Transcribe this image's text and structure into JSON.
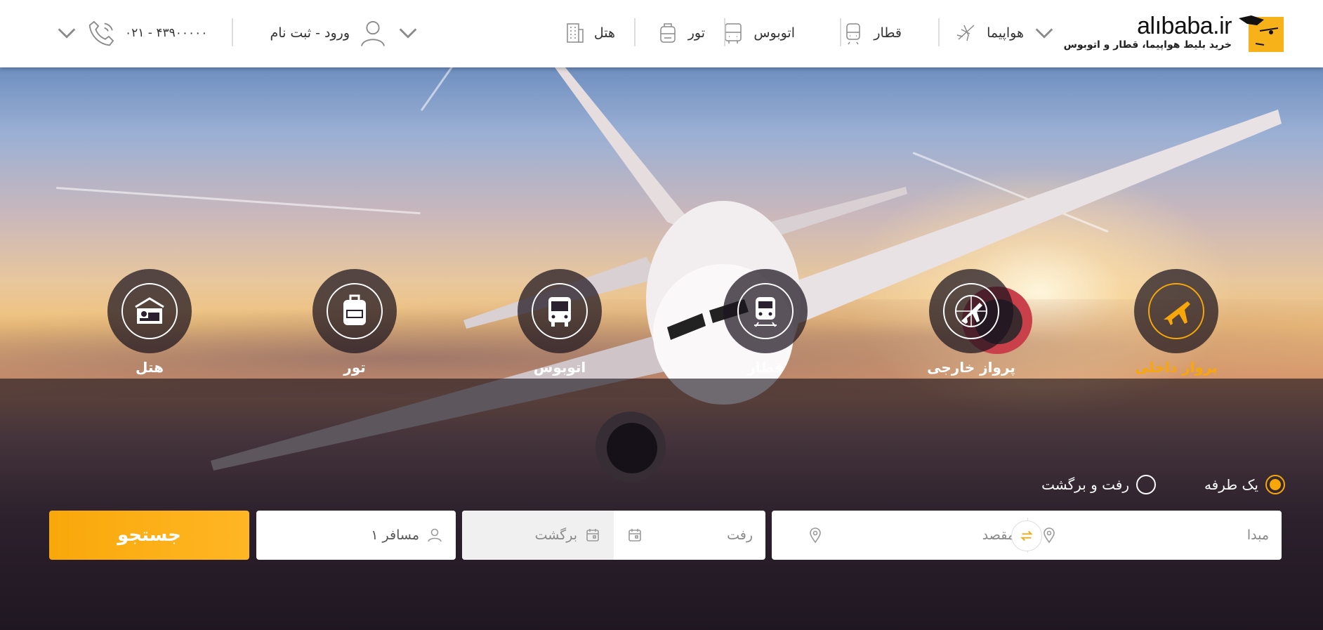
{
  "header": {
    "logo_text": "alıbaba.ir",
    "logo_tagline": "خرید بلیط هواپیما، قطار و اتوبوس",
    "nav": [
      {
        "label": "هواپیما",
        "icon": "plane-icon",
        "has_dropdown": true
      },
      {
        "label": "قطار",
        "icon": "train-icon"
      },
      {
        "label": "اتوبوس",
        "icon": "bus-icon"
      },
      {
        "label": "تور",
        "icon": "backpack-icon"
      },
      {
        "label": "هتل",
        "icon": "hotel-building-icon"
      }
    ],
    "auth_label": "ورود - ثبت نام",
    "phone": "۰۲۱ - ۴۳۹۰۰۰۰۰"
  },
  "services": [
    {
      "label": "پرواز داخلی",
      "icon": "domestic-flight-icon",
      "active": true
    },
    {
      "label": "پرواز خارجی",
      "icon": "international-flight-icon",
      "active": false
    },
    {
      "label": "قطار",
      "icon": "train-icon",
      "active": false
    },
    {
      "label": "اتوبوس",
      "icon": "bus-icon",
      "active": false
    },
    {
      "label": "تور",
      "icon": "backpack-icon",
      "active": false
    },
    {
      "label": "هتل",
      "icon": "hotel-bed-icon",
      "active": false
    }
  ],
  "trip_type": {
    "one_way": "یک طرفه",
    "round_trip": "رفت و برگشت",
    "selected": "one_way"
  },
  "search": {
    "origin_placeholder": "مبدا",
    "destination_placeholder": "مقصد",
    "depart_placeholder": "رفت",
    "return_placeholder": "برگشت",
    "passengers": "۱ مسافر",
    "button": "جستجو"
  },
  "colors": {
    "accent": "#f7a70a",
    "header_bg": "#ffffff",
    "field_disabled": "#f0f0f0"
  }
}
